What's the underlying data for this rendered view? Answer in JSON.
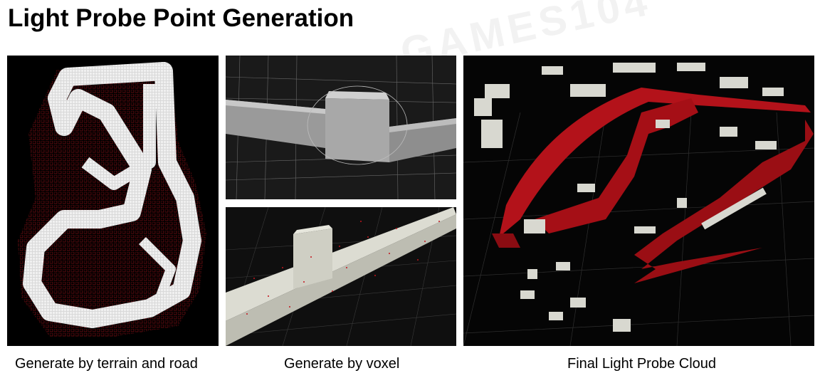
{
  "slide": {
    "title": "Light Probe Point Generation",
    "watermark": "GAMES104"
  },
  "panels": [
    {
      "caption": "Generate by terrain and road"
    },
    {
      "caption": "Generate by voxel"
    },
    {
      "caption": "Final Light Probe Cloud"
    }
  ],
  "colors": {
    "probe_red": "#b3121a",
    "probe_white": "#e8e8e0",
    "panel_bg": "#000000"
  }
}
